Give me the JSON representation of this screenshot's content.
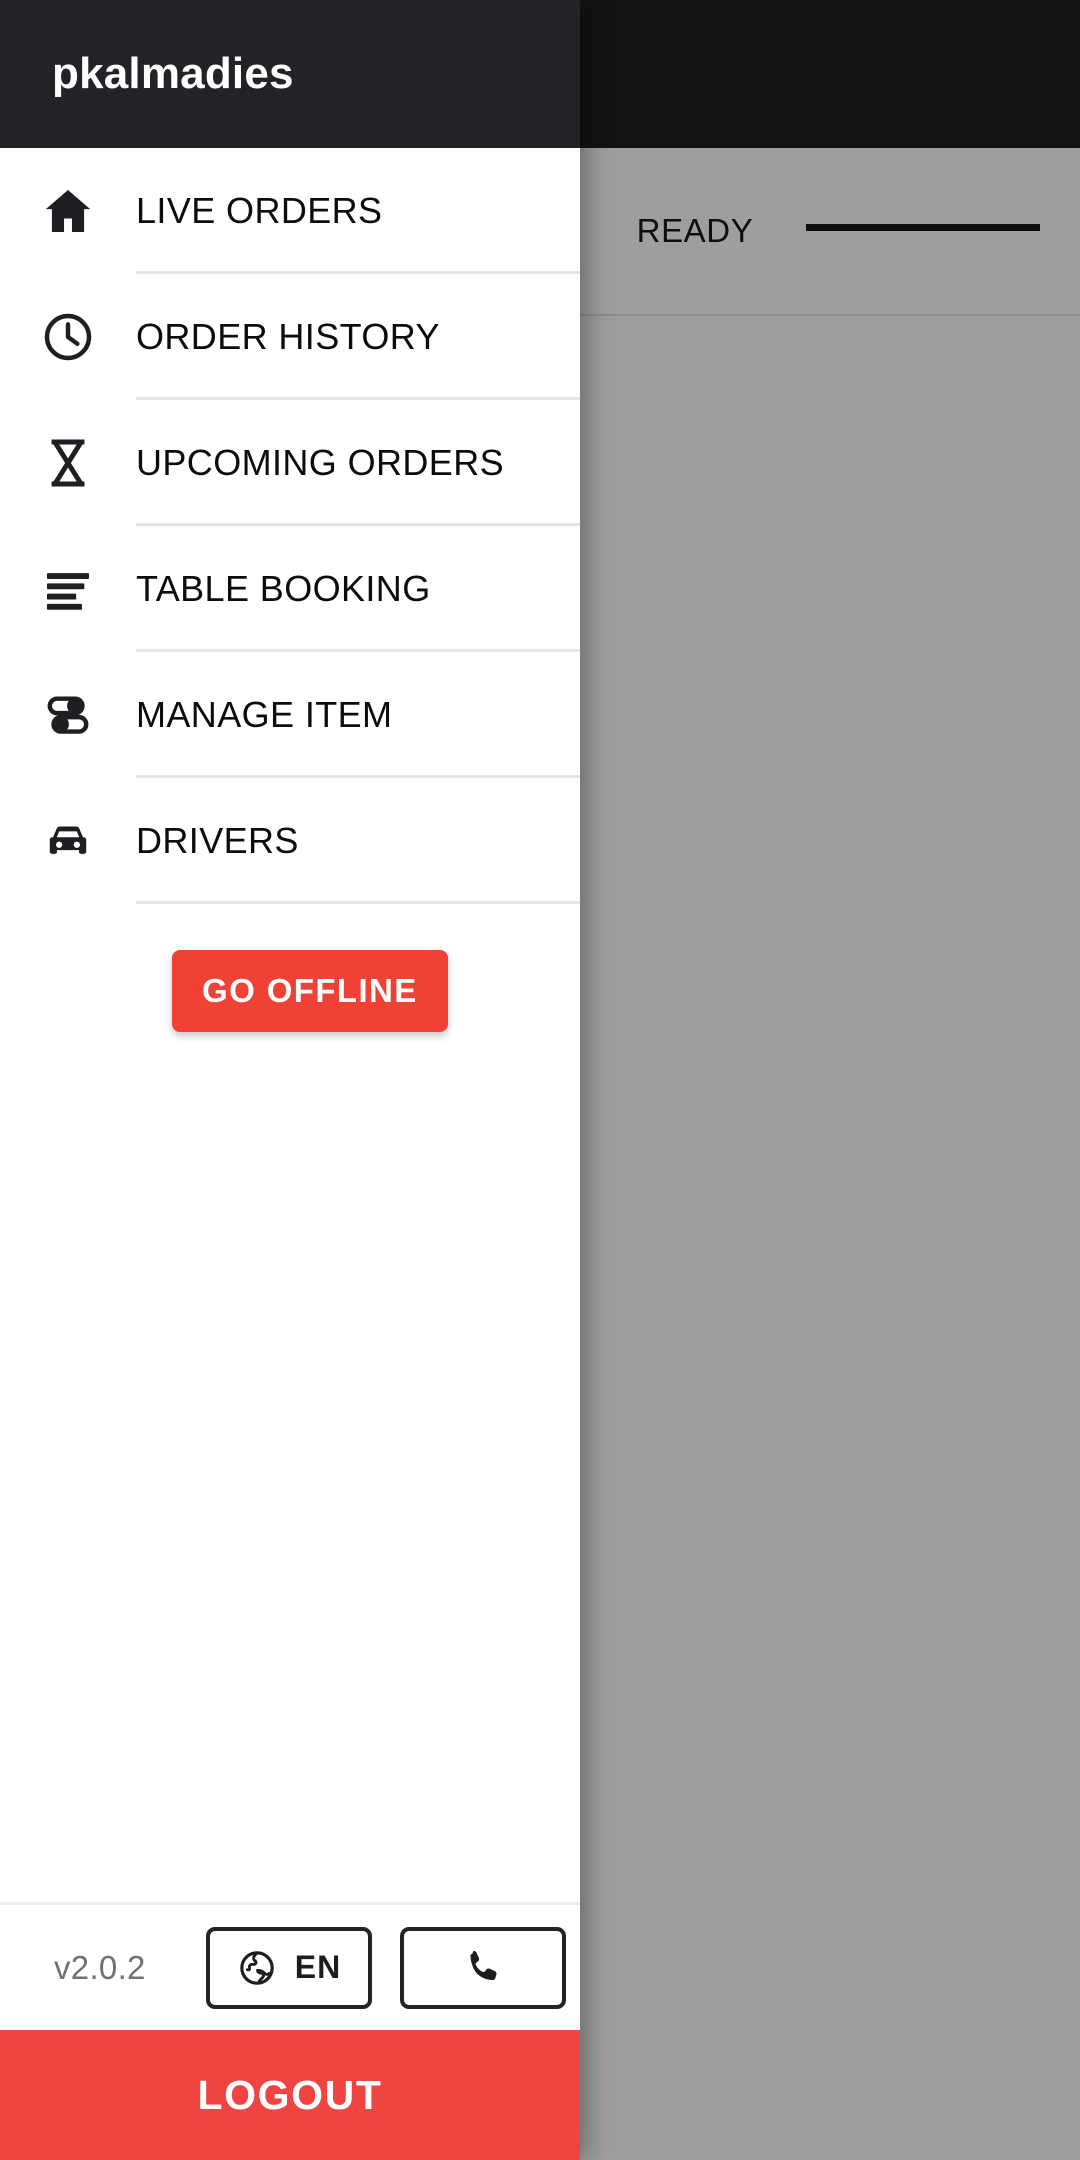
{
  "app": {
    "window_title": "pkalmadies",
    "tabs": [
      {
        "label": "READY",
        "selected": true
      }
    ]
  },
  "drawer": {
    "title": "pkalmadies",
    "menu": [
      {
        "label": "LIVE ORDERS",
        "icon": "home-icon"
      },
      {
        "label": "ORDER HISTORY",
        "icon": "clock-icon"
      },
      {
        "label": "UPCOMING ORDERS",
        "icon": "hourglass-icon"
      },
      {
        "label": "TABLE BOOKING",
        "icon": "list-lines-icon"
      },
      {
        "label": "MANAGE ITEM",
        "icon": "toggles-icon"
      },
      {
        "label": "DRIVERS",
        "icon": "car-icon"
      }
    ],
    "offline_button": {
      "label": "GO OFFLINE",
      "color": "#ef4136"
    },
    "footer": {
      "version": "v2.0.2",
      "language_button": {
        "label": "EN",
        "icon": "globe-icon"
      },
      "call_button": {
        "label": "",
        "icon": "phone-icon"
      }
    },
    "logout_button": {
      "label": "LOGOUT",
      "color": "#ef4540"
    }
  },
  "colors": {
    "header_bg": "#212326",
    "accent_red": "#ef4136",
    "logout_red": "#ef4540",
    "divider": "#e4e4e4",
    "text_primary": "#0b0c0d",
    "text_muted": "#6e7176"
  }
}
